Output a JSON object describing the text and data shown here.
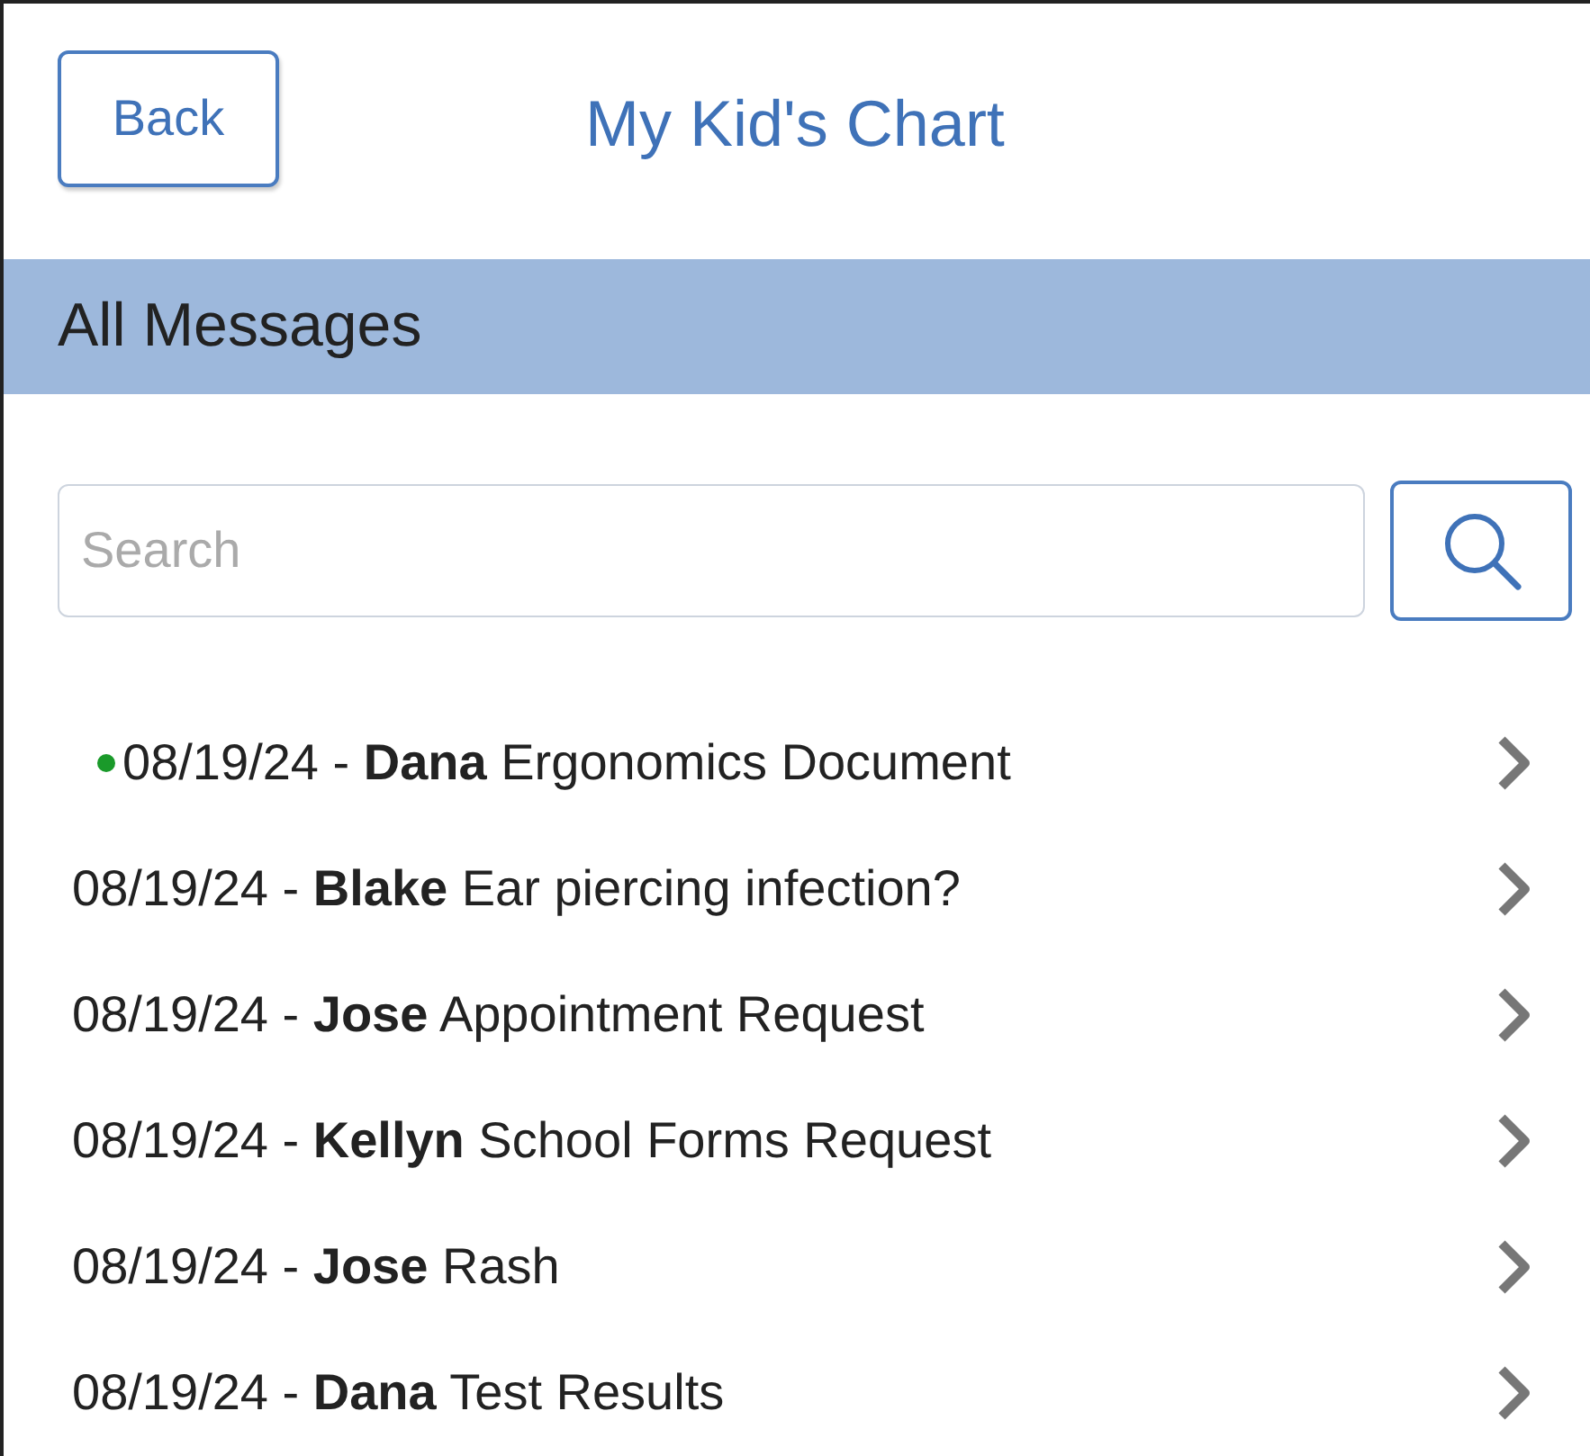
{
  "header": {
    "back_button": "Back",
    "title": "My Kid's Chart"
  },
  "section": {
    "title": "All Messages"
  },
  "search": {
    "placeholder": "Search"
  },
  "messages": [
    {
      "text": "08/19/24 - **Dana** Ergonomics Document",
      "unread": true
    },
    {
      "text": "08/19/24 - **Blake** Ear piercing infection?",
      "unread": false
    },
    {
      "text": "08/19/24 - **Jose** Appointment Request",
      "unread": false
    },
    {
      "text": "08/19/24 - **Kellyn** School Forms Request",
      "unread": false
    },
    {
      "text": "08/19/24 - **Jose** Rash",
      "unread": false
    },
    {
      "text": "08/19/24 - **Dana** Test Results",
      "unread": false
    }
  ]
}
